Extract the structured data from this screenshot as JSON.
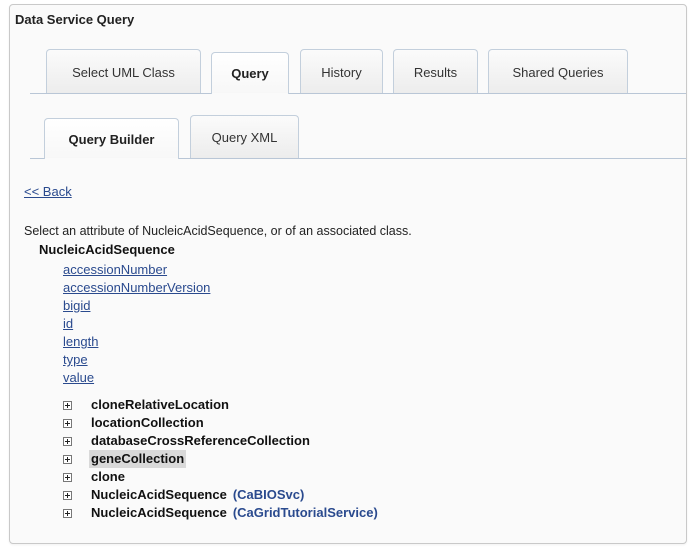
{
  "panel": {
    "title": "Data Service Query"
  },
  "main_tabs": [
    {
      "label": "Select UML Class",
      "active": false
    },
    {
      "label": "Query",
      "active": true
    },
    {
      "label": "History",
      "active": false
    },
    {
      "label": "Results",
      "active": false
    },
    {
      "label": "Shared Queries",
      "active": false
    }
  ],
  "sub_tabs": [
    {
      "label": "Query Builder",
      "active": true
    },
    {
      "label": "Query XML",
      "active": false
    }
  ],
  "back_link": "<< Back",
  "instructions": "Select an attribute of NucleicAcidSequence, or of an associated class.",
  "class_name": "NucleicAcidSequence",
  "attributes": [
    "accessionNumber",
    "accessionNumberVersion",
    "bigid",
    "id",
    "length",
    "type",
    "value"
  ],
  "associations": [
    {
      "label": "cloneRelativeLocation",
      "service": "",
      "highlighted": false,
      "icon": "plus-expander-icon"
    },
    {
      "label": "locationCollection",
      "service": "",
      "highlighted": false,
      "icon": "plus-expander-icon"
    },
    {
      "label": "databaseCrossReferenceCollection",
      "service": "",
      "highlighted": false,
      "icon": "plus-expander-icon"
    },
    {
      "label": "geneCollection",
      "service": "",
      "highlighted": true,
      "icon": "plus-expander-icon"
    },
    {
      "label": "clone",
      "service": "",
      "highlighted": false,
      "icon": "plus-expander-icon"
    },
    {
      "label": "NucleicAcidSequence",
      "service": "(CaBIOSvc)",
      "highlighted": false,
      "icon": "plus-expander-icon"
    },
    {
      "label": "NucleicAcidSequence",
      "service": "(CaGridTutorialService)",
      "highlighted": false,
      "icon": "plus-expander-icon"
    }
  ],
  "colors": {
    "link": "#2a4a8e",
    "tab_border": "#c3cfdc",
    "highlight": "#d9d9d9"
  }
}
